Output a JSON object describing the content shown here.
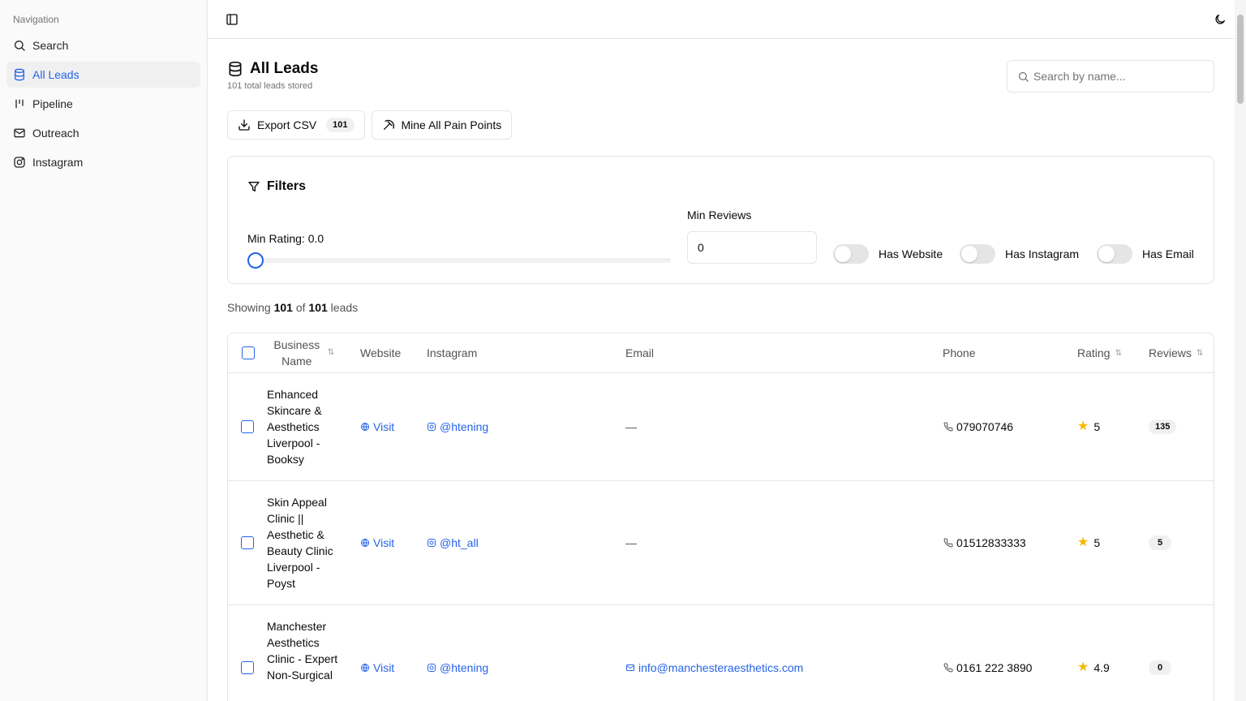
{
  "sidebar": {
    "group_label": "Navigation",
    "items": [
      {
        "label": "Search",
        "icon": "search-icon"
      },
      {
        "label": "All Leads",
        "icon": "database-icon",
        "active": true
      },
      {
        "label": "Pipeline",
        "icon": "kanban-icon"
      },
      {
        "label": "Outreach",
        "icon": "mail-icon"
      },
      {
        "label": "Instagram",
        "icon": "instagram-icon"
      }
    ]
  },
  "topbar": {
    "sidebar_toggle_icon": "panel-left-icon",
    "theme_toggle_icon": "moon-icon"
  },
  "page": {
    "title": "All Leads",
    "subtitle": "101 total leads stored"
  },
  "search": {
    "placeholder": "Search by name...",
    "value": ""
  },
  "actions": {
    "export_label": "Export CSV",
    "export_count": "101",
    "mine_label": "Mine All Pain Points"
  },
  "filters": {
    "title": "Filters",
    "rating_label": "Min Rating: 0.0",
    "rating_value": 0.0,
    "reviews_label": "Min Reviews",
    "reviews_value": "0",
    "toggles": {
      "website": "Has Website",
      "instagram": "Has Instagram",
      "email": "Has Email"
    }
  },
  "summary": {
    "prefix": "Showing",
    "shown": "101",
    "of": "of",
    "total": "101",
    "suffix": "leads"
  },
  "table": {
    "headers": {
      "business_name": "Business Name",
      "website": "Website",
      "instagram": "Instagram",
      "email": "Email",
      "phone": "Phone",
      "rating": "Rating",
      "reviews": "Reviews"
    },
    "rows": [
      {
        "business_name": "Enhanced Skincare & Aesthetics Liverpool - Booksy",
        "website": "Visit",
        "instagram": "@htening",
        "email": "—",
        "phone": "079070746",
        "rating": "5",
        "reviews": "135"
      },
      {
        "business_name": "Skin Appeal Clinic || Aesthetic & Beauty Clinic Liverpool - Poyst",
        "website": "Visit",
        "instagram": "@ht_all",
        "email": "—",
        "phone": "01512833333",
        "rating": "5",
        "reviews": "5"
      },
      {
        "business_name": "Manchester Aesthetics Clinic - Expert Non-Surgical",
        "website": "Visit",
        "instagram": "@htening",
        "email": "info@manchesteraesthetics.com",
        "phone": "0161 222 3890",
        "rating": "4.9",
        "reviews": "0"
      }
    ]
  },
  "colors": {
    "accent": "#2563eb",
    "star": "#f5b800",
    "border": "#e5e5e5",
    "sidebar_bg": "#fafafa"
  }
}
